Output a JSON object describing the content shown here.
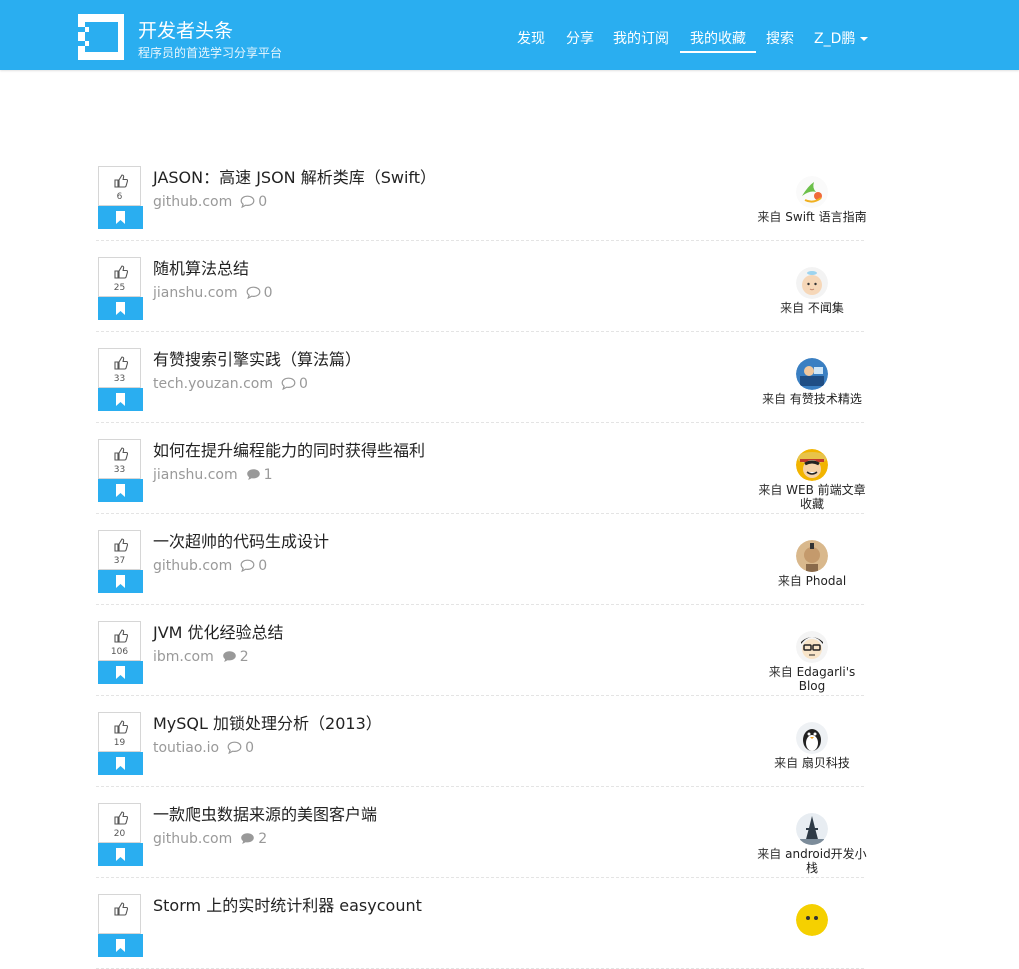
{
  "brand": {
    "title": "开发者头条",
    "subtitle": "程序员的首选学习分享平台"
  },
  "nav": {
    "items": [
      "发现",
      "分享",
      "我的订阅",
      "我的收藏",
      "搜索"
    ],
    "active_index": 3,
    "user": "Z_D鹏"
  },
  "source_prefix": "来自",
  "articles": [
    {
      "votes": "6",
      "title": "JASON：高速 JSON 解析类库（Swift）",
      "domain": "github.com",
      "comments": "0",
      "source": "Swift 语言指南",
      "avatar": "swift-guide-avatar",
      "comment_filled": false
    },
    {
      "votes": "25",
      "title": "随机算法总结",
      "domain": "jianshu.com",
      "comments": "0",
      "source": "不闻集",
      "avatar": "baby-avatar",
      "comment_filled": false
    },
    {
      "votes": "33",
      "title": "有赞搜索引擎实践（算法篇）",
      "domain": "tech.youzan.com",
      "comments": "0",
      "source": "有赞技术精选",
      "avatar": "youzan-avatar",
      "comment_filled": false
    },
    {
      "votes": "33",
      "title": "如何在提升编程能力的同时获得些福利",
      "domain": "jianshu.com",
      "comments": "1",
      "source": "WEB 前端文章收藏",
      "avatar": "luffy-avatar",
      "comment_filled": true
    },
    {
      "votes": "37",
      "title": "一次超帅的代码生成设计",
      "domain": "github.com",
      "comments": "0",
      "source": "Phodal",
      "avatar": "phodal-avatar",
      "comment_filled": false
    },
    {
      "votes": "106",
      "title": "JVM 优化经验总结",
      "domain": "ibm.com",
      "comments": "2",
      "source": "Edagarli's Blog",
      "avatar": "glasses-avatar",
      "comment_filled": true
    },
    {
      "votes": "19",
      "title": "MySQL 加锁处理分析（2013）",
      "domain": "toutiao.io",
      "comments": "0",
      "source": "扇贝科技",
      "avatar": "penguin-avatar",
      "comment_filled": false
    },
    {
      "votes": "20",
      "title": "一款爬虫数据来源的美图客户端",
      "domain": "github.com",
      "comments": "2",
      "source": "android开发小栈",
      "avatar": "tower-avatar",
      "comment_filled": true
    },
    {
      "votes": "",
      "title": "Storm 上的实时统计利器 easycount",
      "domain": "",
      "comments": "",
      "source": "",
      "avatar": "yellow-avatar",
      "comment_filled": false
    }
  ]
}
